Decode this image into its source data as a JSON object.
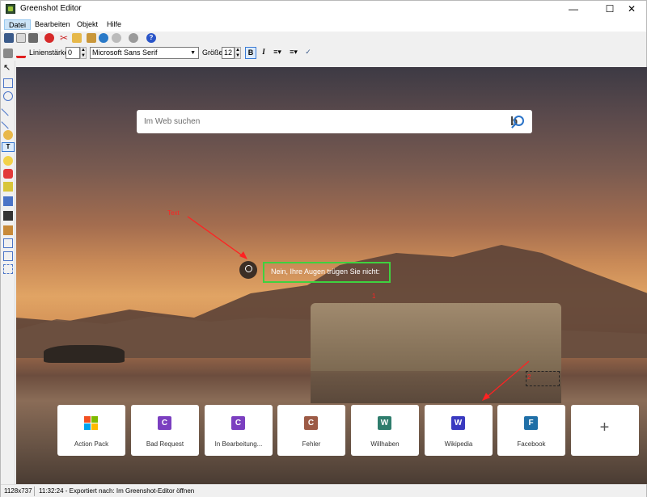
{
  "app": {
    "title": "Greenshot Editor"
  },
  "menu": {
    "items": [
      "Datei",
      "Bearbeiten",
      "Objekt",
      "Hilfe"
    ]
  },
  "format_bar": {
    "line_width_label": "Linienstärke",
    "line_width_value": "0",
    "font": "Microsoft Sans Serif",
    "size_label": "Größe",
    "size_value": "12",
    "bold": "B",
    "italic": "I"
  },
  "browser": {
    "search_placeholder": "Im Web suchen",
    "highlight_text": "Nein, Ihre Augen trügen Sie nicht:",
    "annotation_text": "Text",
    "annotation_1": "1",
    "annotation_2": "2",
    "tiles": [
      {
        "label": "Action Pack",
        "icon": "microsoft-logo-icon",
        "color": ""
      },
      {
        "label": "Bad Request",
        "icon": "C",
        "color": "#7b3fc0"
      },
      {
        "label": "In Bearbeitung...",
        "icon": "C",
        "color": "#7b3fc0"
      },
      {
        "label": "Fehler",
        "icon": "C",
        "color": "#9c5a45"
      },
      {
        "label": "Willhaben",
        "icon": "W",
        "color": "#2f7d6d"
      },
      {
        "label": "Wikipedia",
        "icon": "W",
        "color": "#3a3ac0"
      },
      {
        "label": "Facebook",
        "icon": "F",
        "color": "#1f6fa7"
      },
      {
        "label": "",
        "icon": "+",
        "color": ""
      }
    ]
  },
  "status": {
    "dimensions": "1128x737",
    "message": "11:32:24 - Exportiert nach: Im Greenshot-Editor öffnen"
  }
}
